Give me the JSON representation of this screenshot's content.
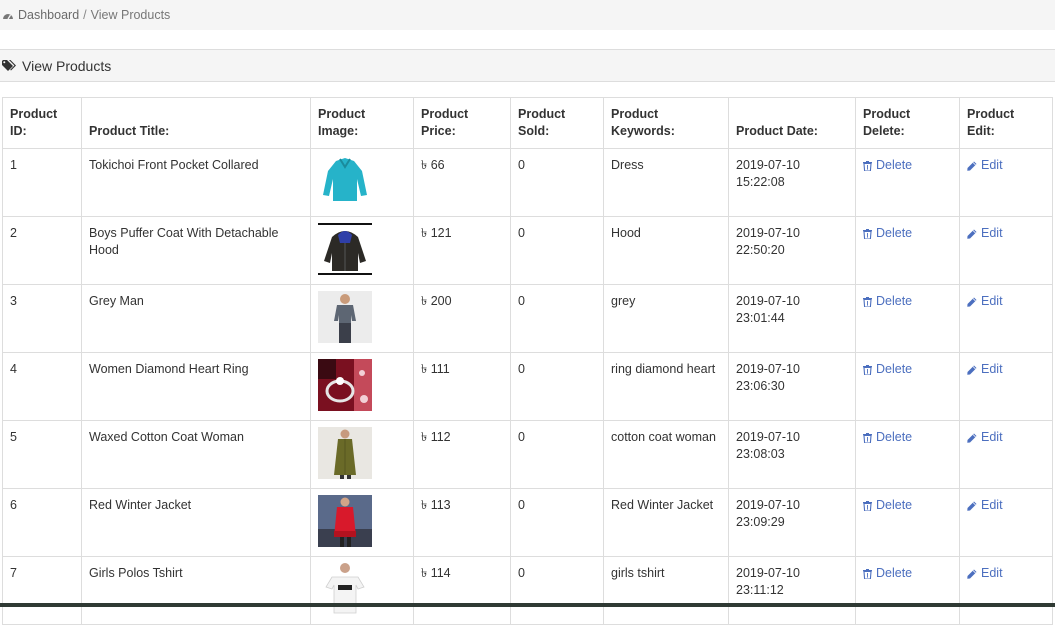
{
  "breadcrumb": {
    "home": "Dashboard",
    "separator": "/",
    "current": "View Products"
  },
  "panel": {
    "title": "View Products"
  },
  "table": {
    "headers": [
      "Product ID:",
      "Product Title:",
      "Product Image:",
      "Product Price:",
      "Product Sold:",
      "Product Keywords:",
      "Product Date:",
      "Product Delete:",
      "Product Edit:"
    ],
    "rows": [
      {
        "id": "1",
        "title": "Tokichoi Front Pocket Collared",
        "image": "teal-jacket",
        "price": "৳ 66",
        "sold": "0",
        "keywords": "Dress",
        "date": "2019-07-10",
        "time": "15:22:08",
        "delete": "Delete",
        "edit": "Edit"
      },
      {
        "id": "2",
        "title": "Boys Puffer Coat With Detachable Hood",
        "image": "black-puffer-coat",
        "price": "৳ 121",
        "sold": "0",
        "keywords": "Hood",
        "date": "2019-07-10",
        "time": "22:50:20",
        "delete": "Delete",
        "edit": "Edit"
      },
      {
        "id": "3",
        "title": "Grey Man",
        "image": "man-grey-tshirt",
        "price": "৳ 200",
        "sold": "0",
        "keywords": "grey",
        "date": "2019-07-10",
        "time": "23:01:44",
        "delete": "Delete",
        "edit": "Edit"
      },
      {
        "id": "4",
        "title": "Women Diamond Heart Ring",
        "image": "diamond-ring",
        "price": "৳ 111",
        "sold": "0",
        "keywords": "ring diamond heart",
        "date": "2019-07-10",
        "time": "23:06:30",
        "delete": "Delete",
        "edit": "Edit"
      },
      {
        "id": "5",
        "title": "Waxed Cotton Coat Woman",
        "image": "olive-coat-woman",
        "price": "৳ 112",
        "sold": "0",
        "keywords": "cotton coat woman",
        "date": "2019-07-10",
        "time": "23:08:03",
        "delete": "Delete",
        "edit": "Edit"
      },
      {
        "id": "6",
        "title": "Red Winter Jacket",
        "image": "red-winter-jacket",
        "price": "৳ 113",
        "sold": "0",
        "keywords": "Red Winter Jacket",
        "date": "2019-07-10",
        "time": "23:09:29",
        "delete": "Delete",
        "edit": "Edit"
      },
      {
        "id": "7",
        "title": "Girls Polos Tshirt",
        "image": "white-tshirt",
        "price": "৳ 114",
        "sold": "0",
        "keywords": "girls tshirt",
        "date": "2019-07-10",
        "time": "23:11:12",
        "delete": "Delete",
        "edit": "Edit"
      }
    ]
  },
  "colors": {
    "link": "#4c6fbf",
    "panel_bg": "#f5f5f5",
    "border": "#dddddd"
  },
  "icons": {
    "breadcrumb": "dashboard-icon",
    "panel": "tags-icon",
    "delete": "trash-icon",
    "edit": "pencil-icon"
  }
}
